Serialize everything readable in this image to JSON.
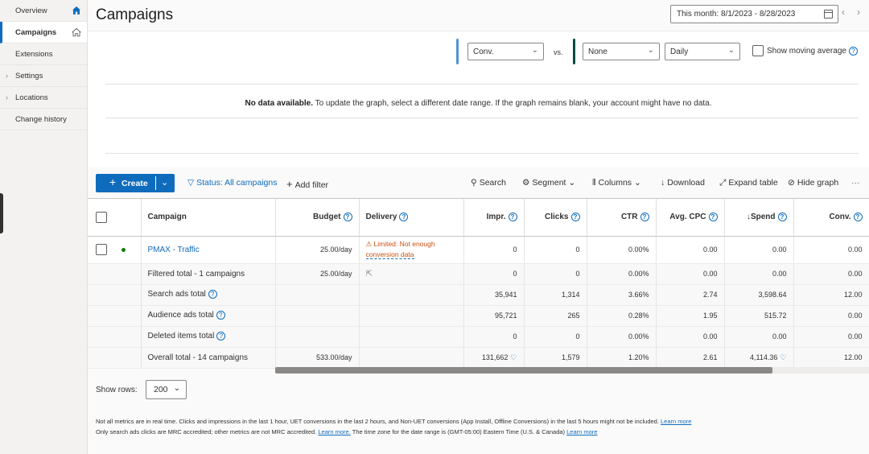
{
  "sidebar": {
    "items": [
      {
        "label": "Overview",
        "chevron": "",
        "home": true
      },
      {
        "label": "Campaigns",
        "chevron": "",
        "home": true,
        "active": true
      },
      {
        "label": "Extensions",
        "chevron": ""
      },
      {
        "label": "Settings",
        "chevron": "›"
      },
      {
        "label": "Locations",
        "chevron": "›"
      },
      {
        "label": "Change history",
        "chevron": ""
      }
    ]
  },
  "header": {
    "title": "Campaigns",
    "date_range": "This month: 8/1/2023 - 8/28/2023",
    "prev_glyph": "‹",
    "next_glyph": "›"
  },
  "graph": {
    "metric1": "Conv.",
    "vs_label": "vs.",
    "metric2": "None",
    "granularity": "Daily",
    "moving_avg_label": "Show moving average",
    "no_data_bold": "No data available.",
    "no_data_text": " To update the graph, select a different date range. If the graph remains blank, your account might have no data.",
    "metric1_color": "#4f94d4",
    "metric2_color": "#0b4a3d"
  },
  "toolbar": {
    "create_label": "Create",
    "create_plus": "+",
    "status_filter": "Status: All campaigns",
    "add_filter": "Add filter",
    "search": "Search",
    "segment": "Segment",
    "columns": "Columns",
    "download": "Download",
    "expand_table": "Expand table",
    "hide_graph": "Hide graph",
    "more": "···"
  },
  "table": {
    "columns": [
      "Campaign",
      "Budget",
      "Delivery",
      "Impr.",
      "Clicks",
      "CTR",
      "Avg. CPC",
      "Spend",
      "Conv."
    ],
    "sort_arrow": "↓",
    "campaign_row": {
      "name": "PMAX - Traffic",
      "budget": "25.00/day",
      "delivery_line1": "Limited: Not enough",
      "delivery_line2": "conversion data",
      "impr": "0",
      "clicks": "0",
      "ctr": "0.00%",
      "cpc": "0.00",
      "spend": "0.00",
      "conv": "0.00"
    },
    "summary_rows": [
      {
        "label": "Filtered total - 1 campaigns",
        "help": false,
        "budget": "25.00/day",
        "impr": "0",
        "clicks": "0",
        "ctr": "0.00%",
        "cpc": "0.00",
        "spend": "0.00",
        "conv": "0.00",
        "impr_icon": false,
        "spend_icon": false
      },
      {
        "label": "Search ads total",
        "help": true,
        "budget": "",
        "impr": "35,941",
        "clicks": "1,314",
        "ctr": "3.66%",
        "cpc": "2.74",
        "spend": "3,598.64",
        "conv": "12.00",
        "impr_icon": false,
        "spend_icon": false
      },
      {
        "label": "Audience ads total",
        "help": true,
        "budget": "",
        "impr": "95,721",
        "clicks": "265",
        "ctr": "0.28%",
        "cpc": "1.95",
        "spend": "515.72",
        "conv": "0.00",
        "impr_icon": false,
        "spend_icon": false
      },
      {
        "label": "Deleted items total",
        "help": true,
        "budget": "",
        "impr": "0",
        "clicks": "0",
        "ctr": "0.00%",
        "cpc": "0.00",
        "spend": "0.00",
        "conv": "0.00",
        "impr_icon": false,
        "spend_icon": false
      },
      {
        "label": "Overall total - 14 campaigns",
        "help": false,
        "budget": "533.00/day",
        "impr": "131,662",
        "clicks": "1,579",
        "ctr": "1.20%",
        "cpc": "2.61",
        "spend": "4,114.36",
        "conv": "12.00",
        "impr_icon": true,
        "spend_icon": true
      }
    ]
  },
  "footer": {
    "show_rows_label": "Show rows:",
    "rows_value": "200",
    "note1": "Not all metrics are in real time. Clicks and impressions in the last 1 hour, UET conversions in the last 2 hours, and Non-UET conversions (App Install, Offline Conversions) in the last 5 hours might not be included.",
    "note1_link": "Learn more",
    "note2": "Only search ads clicks are MRC accredited; other metrics are not MRC accredited.",
    "note2_link": "Learn more.",
    "note3": " The time zone for the date range is (GMT-05:00) Eastern Time (U.S. & Canada)",
    "note3_link": "Learn more"
  }
}
